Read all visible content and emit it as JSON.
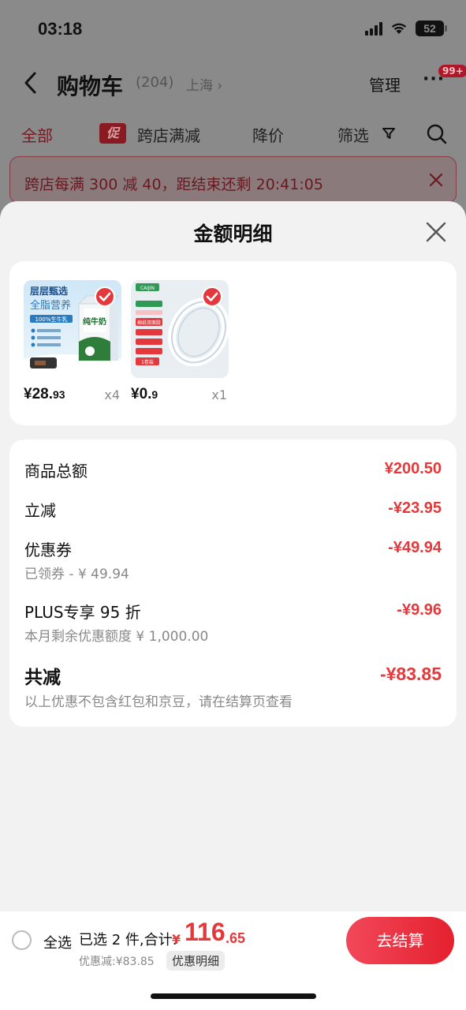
{
  "status": {
    "time": "03:18",
    "battery": "52"
  },
  "nav": {
    "title": "购物车",
    "count": "(204)",
    "location": "上海 ›",
    "manage": "管理",
    "more": "···",
    "badge": "99+"
  },
  "tabs": {
    "all": "全部",
    "promo_tag": "促",
    "cross_store": "跨店满减",
    "price_drop": "降价",
    "filter": "筛选"
  },
  "banner": {
    "text": "跨店每满 300 减 40，距结束还剩 20:41:05"
  },
  "sheet": {
    "title": "金额明细",
    "products": [
      {
        "price_int": "¥28.",
        "price_dec": "93",
        "qty": "x4",
        "image_title": "层层甄选",
        "image_sub": "全脂营养",
        "image_note": "100%生牛乳",
        "image_pack": "纯牛奶"
      },
      {
        "price_int": "¥0.",
        "price_dec": "9",
        "qty": "x1",
        "image_brand": "CAIJIN",
        "image_label": "棉纸双面胶",
        "image_roll": "1卷装"
      }
    ],
    "rows": [
      {
        "label": "商品总额",
        "value": "¥200.50"
      },
      {
        "label": "立减",
        "value": "-¥23.95"
      },
      {
        "label": "优惠券",
        "value": "-¥49.94",
        "sub": "已领券 - ¥ 49.94"
      },
      {
        "label": "PLUS专享 95 折",
        "value": "-¥9.96",
        "sub": "本月剩余优惠额度  ¥ 1,000.00"
      }
    ],
    "total": {
      "label": "共减",
      "value": "-¥83.85",
      "note": "以上优惠不包含红包和京豆，请在结算页查看"
    }
  },
  "bottom": {
    "select_all": "全选",
    "selected": "已选 2 件,合计:",
    "sum_yen": "¥",
    "sum_int": "116",
    "sum_dec": ".65",
    "discount": "优惠减:¥83.85",
    "detail_tag": "优惠明细",
    "checkout": "去结算"
  },
  "colors": {
    "accent": "#e4393c",
    "sheet_bg": "#f2f2f2",
    "overlay": "#8a8a8a"
  }
}
